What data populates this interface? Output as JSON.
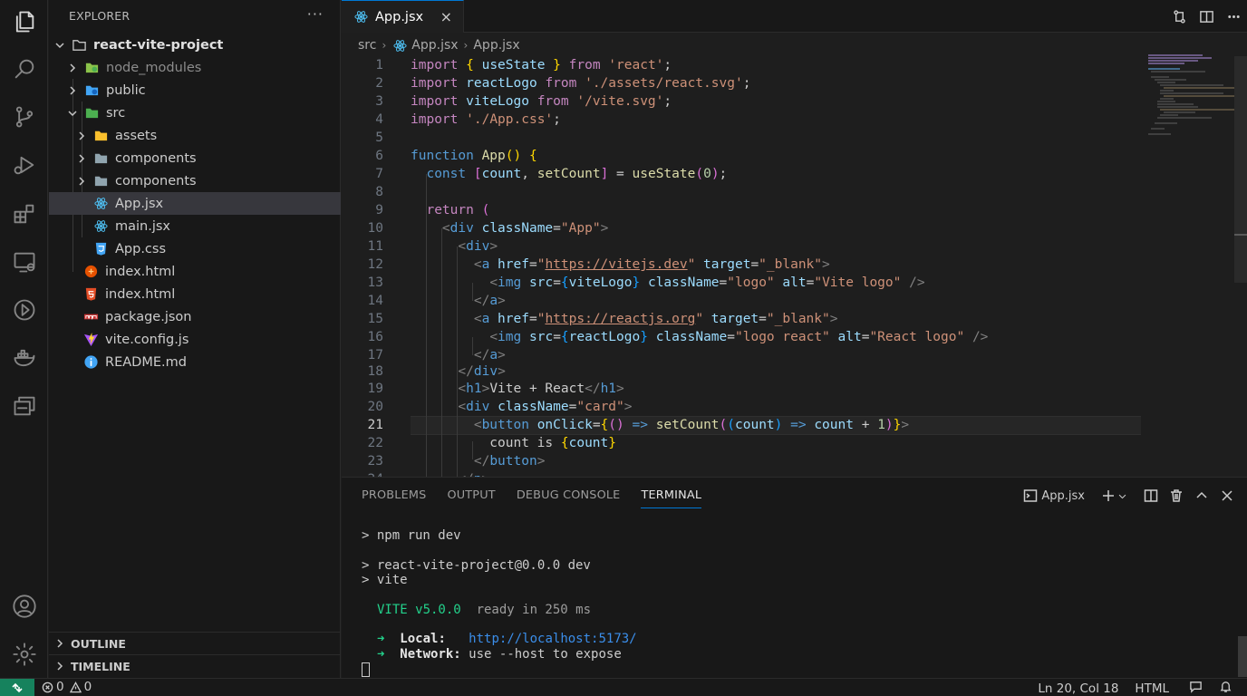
{
  "explorer": {
    "title": "EXPLORER",
    "more": "···",
    "project": "react-vite-project",
    "items": [
      {
        "label": "node_modules"
      },
      {
        "label": "public"
      },
      {
        "label": "src"
      },
      {
        "label": "assets"
      },
      {
        "label": "components"
      },
      {
        "label": "components"
      },
      {
        "label": "App.jsx"
      },
      {
        "label": "main.jsx"
      },
      {
        "label": "App.css"
      },
      {
        "label": "index.html"
      },
      {
        "label": "index.html"
      },
      {
        "label": "package.json"
      },
      {
        "label": "vite.config.js"
      },
      {
        "label": "README.md"
      }
    ],
    "outline": "OUTLINE",
    "timeline": "TIMELINE"
  },
  "editor": {
    "tab_label": "App.jsx",
    "tab_close": "×",
    "breadcrumb": [
      "src",
      "App.jsx",
      "App.jsx"
    ],
    "current_line": 21,
    "line_numbers": [
      "1",
      "2",
      "3",
      "4",
      "5",
      "6",
      "7",
      "8",
      "9",
      "10",
      "11",
      "12",
      "13",
      "14",
      "15",
      "16",
      "17",
      "18",
      "19",
      "20",
      "21",
      "22",
      "23",
      "24"
    ]
  },
  "panel": {
    "tabs": [
      "PROBLEMS",
      "OUTPUT",
      "DEBUG CONSOLE",
      "TERMINAL"
    ],
    "active_tab": "TERMINAL",
    "terminal_name": "App.jsx",
    "terminal": {
      "cmd": "> npm run dev",
      "line2": "> react-vite-project@0.0.0 dev",
      "line3": "> vite",
      "vite_label": "VITE v5.0.0",
      "ready": "ready in 250 ms",
      "arrow": "➜",
      "local_label": "Local:",
      "local_url": "http://localhost:5173/",
      "network_label": "Network:",
      "network_text": "use --host to expose"
    }
  },
  "status": {
    "errors": "0",
    "warnings": "0",
    "position": "Ln 20, Col 18",
    "language": "HTML"
  },
  "colors": {
    "accent": "#0078d4",
    "remote": "#16825d",
    "background": "#1e1e1e",
    "sidebar": "#181818"
  },
  "icons": {
    "activity": [
      "files-icon",
      "search-icon",
      "source-control-icon",
      "run-debug-icon",
      "extensions-icon",
      "remote-explorer-icon",
      "timeline-icon",
      "docker-icon",
      "containers-icon",
      "account-icon",
      "settings-gear-icon"
    ]
  }
}
